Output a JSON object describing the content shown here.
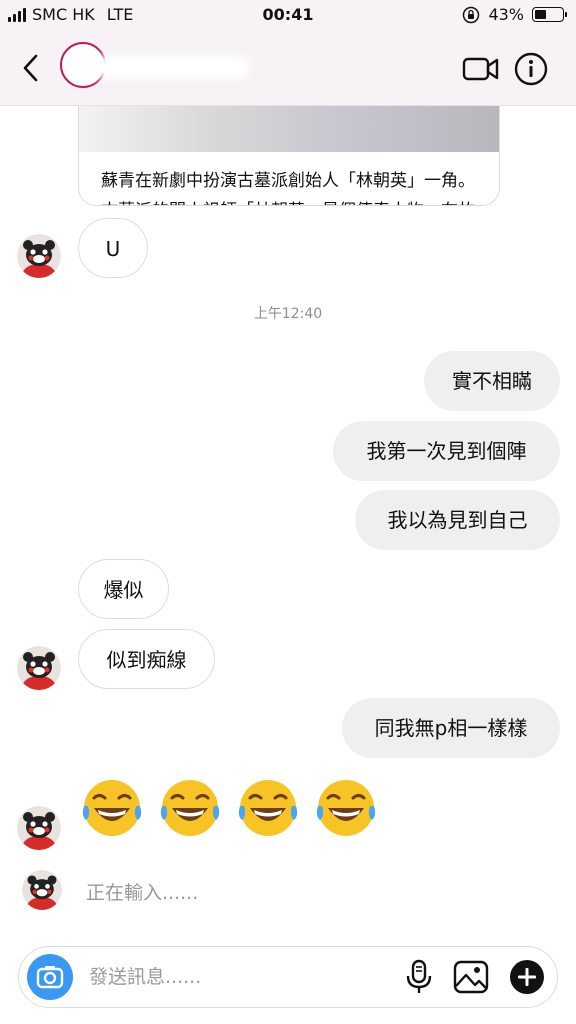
{
  "status_bar": {
    "carrier": "SMC HK",
    "network": "LTE",
    "time": "00:41",
    "battery": "43%",
    "battery_level": 0.43
  },
  "header": {
    "back_icon": "chevron-left-icon",
    "video_icon": "video-camera-icon",
    "info_icon": "info-icon"
  },
  "shared_post": {
    "caption_line1": "蘇青在新劇中扮演古墓派創始人「林朝英」一角。",
    "caption_line2": "古墓派的開山祖師「林朝英」是個傳奇人物，在故"
  },
  "messages": [
    {
      "side": "in",
      "text": "U"
    },
    {
      "side": "out",
      "text": "實不相瞞"
    },
    {
      "side": "out",
      "text": "我第一次見到個陣"
    },
    {
      "side": "out",
      "text": "我以為見到自己"
    },
    {
      "side": "in",
      "text": "爆似"
    },
    {
      "side": "in",
      "text": "似到痴線"
    },
    {
      "side": "out",
      "text": "同我無p相一樣樣"
    },
    {
      "side": "in",
      "text": "😂😂😂😂"
    }
  ],
  "timestamp": "上午12:40",
  "typing_indicator": "正在輸入......",
  "composer": {
    "placeholder": "發送訊息......"
  },
  "colors": {
    "bar_bg": "#f7f2f6",
    "outgoing_bubble": "#efefef",
    "camera_button": "#3a97f4",
    "story_ring": "#c2185b"
  }
}
